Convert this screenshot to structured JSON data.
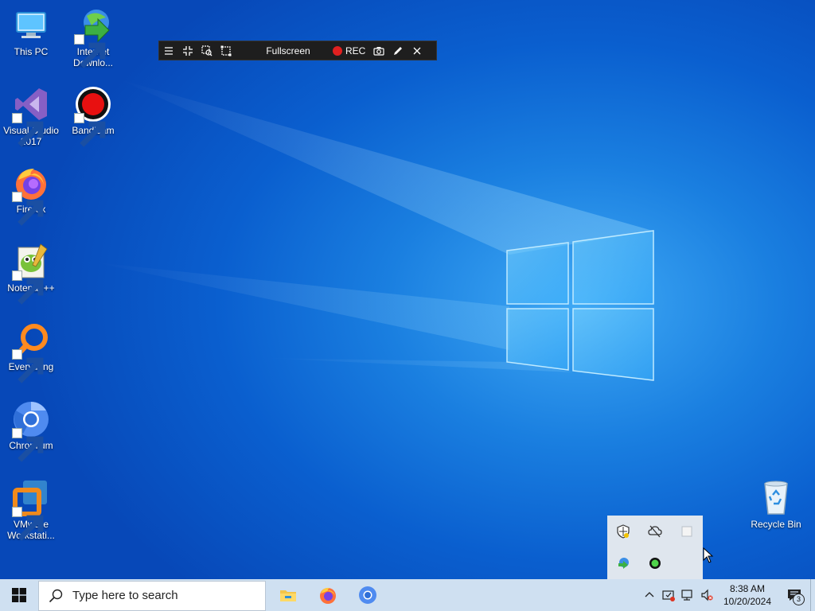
{
  "desktop": {
    "icons": [
      {
        "label": "This PC",
        "icon": "computer-icon"
      },
      {
        "label": "Internet Downlo...",
        "icon": "internet-download-manager-icon"
      },
      {
        "label": "Visual Studio 2017",
        "icon": "visual-studio-icon"
      },
      {
        "label": "Bandicam",
        "icon": "bandicam-icon"
      },
      {
        "label": "Firefox",
        "icon": "firefox-icon"
      },
      {
        "label": "Notepad++",
        "icon": "notepad-plus-plus-icon"
      },
      {
        "label": "Everything",
        "icon": "everything-search-icon"
      },
      {
        "label": "Chromium",
        "icon": "chromium-icon"
      },
      {
        "label": "VMware Workstati...",
        "icon": "vmware-icon"
      },
      {
        "label": "Recycle Bin",
        "icon": "recycle-bin-icon"
      }
    ]
  },
  "bandicam_toolbar": {
    "mode_label": "Fullscreen",
    "rec_label": "REC",
    "rec_color": "#e02020"
  },
  "taskbar": {
    "search_placeholder": "Type here to search",
    "apps": [
      "file-explorer-icon",
      "firefox-icon",
      "chromium-icon"
    ],
    "clock_time": "8:38 AM",
    "clock_date": "10/20/2024",
    "notification_count": "3",
    "background": "#cfe0f1"
  },
  "tray_flyout": {
    "icons": [
      "windows-security-icon",
      "onedrive-offline-icon",
      "blank-app-icon",
      "internet-download-manager-icon",
      "bandicam-tray-icon"
    ]
  }
}
